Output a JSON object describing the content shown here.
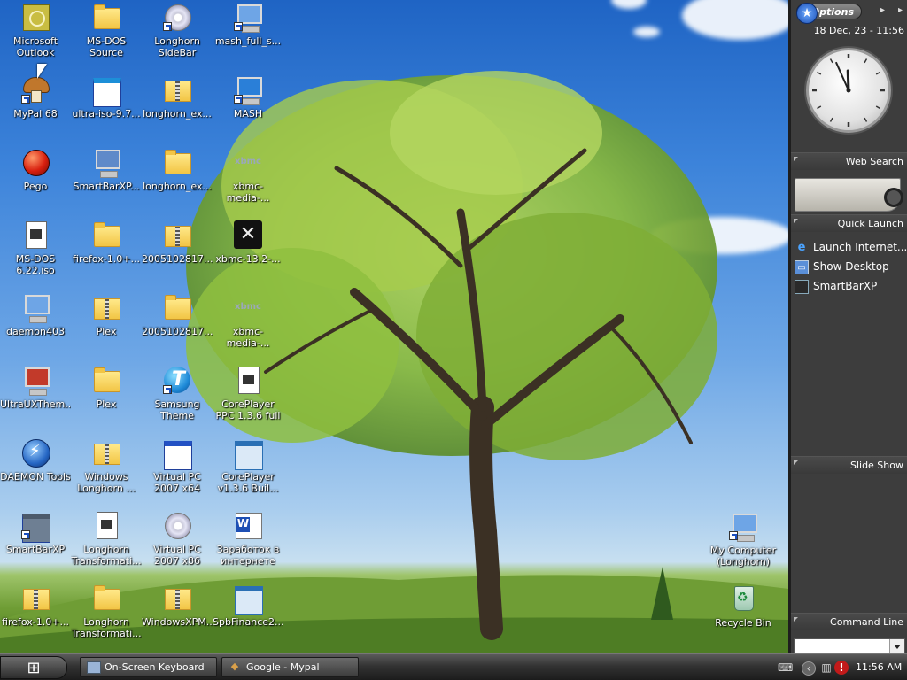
{
  "desktop": {
    "icons": [
      {
        "label": "Microsoft Outlook",
        "icon": "outlook-icon",
        "shortcut": false
      },
      {
        "label": "MS-DOS Source",
        "icon": "folder-icon",
        "shortcut": false
      },
      {
        "label": "Longhorn SideBar",
        "icon": "disc-icon",
        "shortcut": true
      },
      {
        "label": "mash_full_s...",
        "icon": "computer-icon",
        "shortcut": true
      },
      {
        "label": "MyPal 68",
        "icon": "mushroom-icon",
        "shortcut": true
      },
      {
        "label": "ultra-iso-9.7...",
        "icon": "installer-icon",
        "shortcut": false
      },
      {
        "label": "longhorn_ex...",
        "icon": "zip-folder-icon",
        "shortcut": false
      },
      {
        "label": "MASH",
        "icon": "mash-icon",
        "shortcut": true
      },
      {
        "label": "Pego",
        "icon": "red-orb-icon",
        "shortcut": false
      },
      {
        "label": "SmartBarXP...",
        "icon": "setup-icon",
        "shortcut": false
      },
      {
        "label": "longhorn_ex...",
        "icon": "folder-icon",
        "shortcut": false
      },
      {
        "label": "xbmc-media-...",
        "icon": "xbmc-icon",
        "shortcut": false
      },
      {
        "label": "MS-DOS 6.22.iso",
        "icon": "iso-document-icon",
        "shortcut": false
      },
      {
        "label": "firefox-1.0+...",
        "icon": "folder-icon",
        "shortcut": false
      },
      {
        "label": "2005102817...",
        "icon": "zip-folder-icon",
        "shortcut": false
      },
      {
        "label": "xbmc-13.2-...",
        "icon": "xbmc-app-icon",
        "shortcut": false
      },
      {
        "label": "daemon403",
        "icon": "computer-disc-icon",
        "shortcut": false
      },
      {
        "label": "Plex",
        "icon": "zip-folder-icon",
        "shortcut": false
      },
      {
        "label": "2005102817...",
        "icon": "folder-icon",
        "shortcut": false
      },
      {
        "label": "xbmc-media-...",
        "icon": "xbmc-icon",
        "shortcut": false
      },
      {
        "label": "UltraUXThem...",
        "icon": "theme-icon",
        "shortcut": false
      },
      {
        "label": "Plex",
        "icon": "folder-icon",
        "shortcut": false
      },
      {
        "label": "Samsung Theme",
        "icon": "samsung-theme-icon",
        "shortcut": true
      },
      {
        "label": "CorePlayer PPC 1.3.6 full",
        "icon": "archive-document-icon",
        "shortcut": false
      },
      {
        "label": "DAEMON Tools",
        "icon": "daemon-tools-icon",
        "shortcut": false
      },
      {
        "label": "Windows Longhorn ...",
        "icon": "zip-folder-icon",
        "shortcut": false
      },
      {
        "label": "Virtual PC 2007 x64",
        "icon": "window-app-icon",
        "shortcut": false
      },
      {
        "label": "CorePlayer v1.3.6 Buil...",
        "icon": "installer-box-icon",
        "shortcut": false
      },
      {
        "label": "SmartBarXP",
        "icon": "smartbar-icon",
        "shortcut": true
      },
      {
        "label": "Longhorn Transformati...",
        "icon": "archive-document-icon",
        "shortcut": false
      },
      {
        "label": "Virtual PC 2007 x86",
        "icon": "disc-icon",
        "shortcut": false
      },
      {
        "label": "Заработок в интернете",
        "icon": "word-document-icon",
        "shortcut": false
      },
      {
        "label": "firefox-1.0+...",
        "icon": "zip-folder-icon",
        "shortcut": false
      },
      {
        "label": "Longhorn Transformati...",
        "icon": "folder-icon",
        "shortcut": false
      },
      {
        "label": "WindowsXPM...",
        "icon": "zip-folder-icon",
        "shortcut": false
      },
      {
        "label": "SpbFinance2...",
        "icon": "installer-box-icon",
        "shortcut": false
      }
    ],
    "right_icons": [
      {
        "label": "My Computer (Longhorn)",
        "icon": "my-computer-icon",
        "shortcut": true
      },
      {
        "label": "Recycle Bin",
        "icon": "recycle-bin-icon",
        "shortcut": false
      }
    ]
  },
  "sidebar": {
    "options_label": "Options",
    "datetime": "18 Dec, 23 - 11:56",
    "clock": {
      "hour": 11,
      "minute": 56
    },
    "sections": {
      "web_search": "Web Search",
      "quick_launch": "Quick Launch",
      "slide_show": "Slide Show",
      "command_line": "Command Line"
    },
    "quick_launch_items": [
      {
        "label": "Launch Internet...",
        "icon": "internet-explorer-icon"
      },
      {
        "label": "Show Desktop",
        "icon": "show-desktop-icon"
      },
      {
        "label": "SmartBarXP",
        "icon": "smartbar-icon"
      }
    ],
    "command_line_value": ""
  },
  "taskbar": {
    "start_glyph": "⊞",
    "tasks": [
      {
        "label": "On-Screen Keyboard",
        "icon": "keyboard-icon"
      },
      {
        "label": "Google - Mypal",
        "icon": "mypal-icon"
      }
    ],
    "time": "11:56 AM"
  },
  "colors": {
    "sidebar_bg": "#3d3d3d",
    "taskbar_dark": "#1c1c1c",
    "sky_top": "#1f64c4",
    "grass": "#6f9d35"
  }
}
